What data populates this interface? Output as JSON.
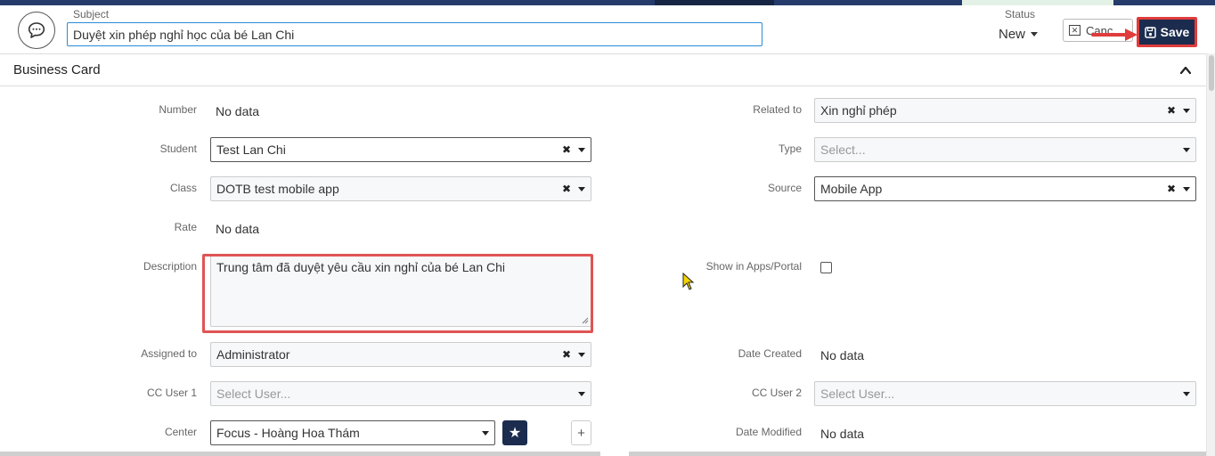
{
  "header": {
    "subject_label": "Subject",
    "subject_value": "Duyệt xin phép nghỉ học của bé Lan Chi",
    "status_label": "Status",
    "status_value": "New",
    "cancel_label": "Canc",
    "save_label": "Save"
  },
  "section": {
    "title": "Business Card"
  },
  "left": {
    "number_label": "Number",
    "number_value": "No data",
    "student_label": "Student",
    "student_value": "Test Lan Chi",
    "class_label": "Class",
    "class_value": "DOTB test mobile app",
    "rate_label": "Rate",
    "rate_value": "No data",
    "description_label": "Description",
    "description_value": "Trung tâm đã duyệt yêu cầu xin nghỉ của bé Lan Chi",
    "assigned_label": "Assigned to",
    "assigned_value": "Administrator",
    "cc1_label": "CC User 1",
    "cc1_placeholder": "Select User...",
    "center_label": "Center",
    "center_value": "Focus - Hoàng Hoa Thám"
  },
  "right": {
    "related_label": "Related to",
    "related_value": "Xin nghỉ phép",
    "type_label": "Type",
    "type_placeholder": "Select...",
    "source_label": "Source",
    "source_value": "Mobile App",
    "show_label": "Show in Apps/Portal",
    "date_created_label": "Date Created",
    "date_created_value": "No data",
    "cc2_label": "CC User 2",
    "cc2_placeholder": "Select User...",
    "date_modified_label": "Date Modified",
    "date_modified_value": "No data"
  },
  "colors": {
    "primary_dark": "#1c2c4f",
    "highlight_red": "#e03c3c",
    "focus_blue": "#2a8bd6"
  },
  "icons": {
    "chat": "chat-bubble-icon",
    "cancel": "close-box-icon",
    "save": "floppy-disk-icon",
    "collapse": "chevron-up-icon",
    "favorite": "star-icon",
    "add": "plus-icon"
  }
}
